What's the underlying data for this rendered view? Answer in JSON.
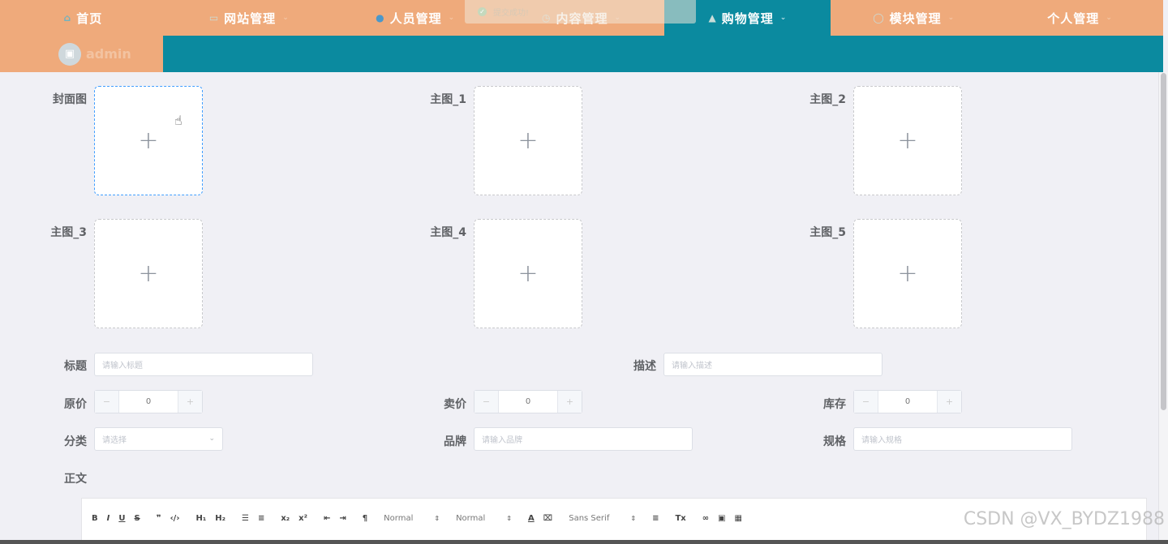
{
  "nav": {
    "items": [
      {
        "label": "首页",
        "icon": "home-icon"
      },
      {
        "label": "网站管理",
        "icon": "monitor-icon"
      },
      {
        "label": "人员管理",
        "icon": "user-icon"
      },
      {
        "label": "内容管理",
        "icon": "clock-icon"
      },
      {
        "label": "购物管理",
        "icon": "lock-icon"
      },
      {
        "label": "模块管理",
        "icon": "chat-icon"
      },
      {
        "label": "个人管理",
        "icon": ""
      }
    ],
    "active": "购物管理",
    "active_color": "#0b8a9f",
    "bar_color": "#efaa7b"
  },
  "user": {
    "name": "admin"
  },
  "toast": {
    "message": "提交成功!"
  },
  "form": {
    "uploads": [
      {
        "label": "封面图"
      },
      {
        "label": "主图_1"
      },
      {
        "label": "主图_2"
      },
      {
        "label": "主图_3"
      },
      {
        "label": "主图_4"
      },
      {
        "label": "主图_5"
      }
    ],
    "title": {
      "label": "标题",
      "placeholder": "请输入标题"
    },
    "desc": {
      "label": "描述",
      "placeholder": "请输入描述"
    },
    "original_price": {
      "label": "原价",
      "value": "0"
    },
    "sale_price": {
      "label": "卖价",
      "value": "0"
    },
    "stock": {
      "label": "库存",
      "value": "0"
    },
    "category": {
      "label": "分类",
      "placeholder": "请选择"
    },
    "brand": {
      "label": "品牌",
      "placeholder": "请输入品牌"
    },
    "spec": {
      "label": "规格",
      "placeholder": "请输入规格"
    },
    "body": {
      "label": "正文"
    }
  },
  "editor": {
    "header1": "Normal",
    "header2": "Normal",
    "font": "Sans Serif"
  },
  "watermark": "CSDN @VX_BYDZ1988"
}
